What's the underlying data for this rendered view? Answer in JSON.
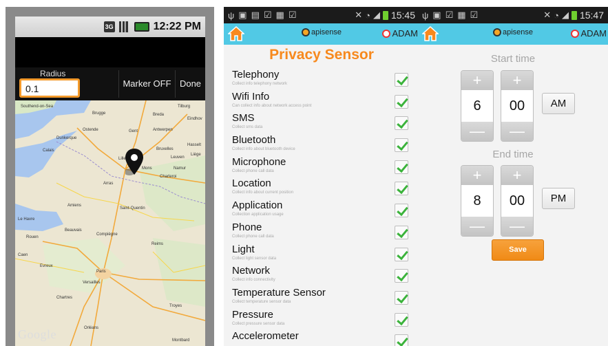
{
  "map_screen": {
    "status_time": "12:22 PM",
    "status_network": "3G",
    "radius_label": "Radius",
    "radius_value": "0.1",
    "marker_button": "Marker OFF",
    "done_button": "Done",
    "map_watermark": "Google",
    "map_labels": [
      "Southend-on-Sea",
      "Brugge",
      "Tilburg",
      "Breda",
      "Eindhov",
      "Gent",
      "Antwerpen",
      "Ostende",
      "Dunkerque",
      "Lille",
      "Bruxelles",
      "Hasselt",
      "Leuven",
      "Mons",
      "Namur",
      "Charleroi",
      "Liège",
      "Amiens",
      "Saint-Quentin",
      "Rouen",
      "Beauvais",
      "Compiègne",
      "Reims",
      "Evreux",
      "Paris",
      "Versailles",
      "Chartres",
      "Orléans",
      "Troyes",
      "Montbard",
      "Le Havre",
      "Caen",
      "Calais",
      "Arras"
    ]
  },
  "privacy_screen": {
    "status_time": "15:45",
    "brand": "apisense",
    "user": "ADAM",
    "title": "Privacy Sensor",
    "sensors": [
      {
        "name": "Telephony",
        "desc": "Collect info telephony network",
        "checked": true
      },
      {
        "name": "Wifi Info",
        "desc": "Can collect info about network access point",
        "checked": true
      },
      {
        "name": "SMS",
        "desc": "Collect sms data",
        "checked": true
      },
      {
        "name": "Bluetooth",
        "desc": "Collect info about bluetooth device",
        "checked": true
      },
      {
        "name": "Microphone",
        "desc": "Collect phone call data",
        "checked": true
      },
      {
        "name": "Location",
        "desc": "Collect info about current position",
        "checked": true
      },
      {
        "name": "Application",
        "desc": "Collection application usage",
        "checked": true
      },
      {
        "name": "Phone",
        "desc": "Collect phone call data",
        "checked": true
      },
      {
        "name": "Light",
        "desc": "Collect light sensor data",
        "checked": true
      },
      {
        "name": "Network",
        "desc": "Collect info connectivity",
        "checked": true
      },
      {
        "name": "Temperature Sensor",
        "desc": "Collect temperature sensor data",
        "checked": true
      },
      {
        "name": "Pressure",
        "desc": "Collect pressure sensor data",
        "checked": true
      },
      {
        "name": "Accelerometer",
        "desc": "",
        "checked": true
      }
    ]
  },
  "time_screen": {
    "status_time": "15:47",
    "brand": "apisense",
    "user": "ADAM",
    "start_label": "Start time",
    "start_hour": "6",
    "start_minute": "00",
    "start_ampm": "AM",
    "end_label": "End time",
    "end_hour": "8",
    "end_minute": "00",
    "end_ampm": "PM",
    "plus_symbol": "+",
    "minus_symbol": "—",
    "save_button": "Save"
  }
}
